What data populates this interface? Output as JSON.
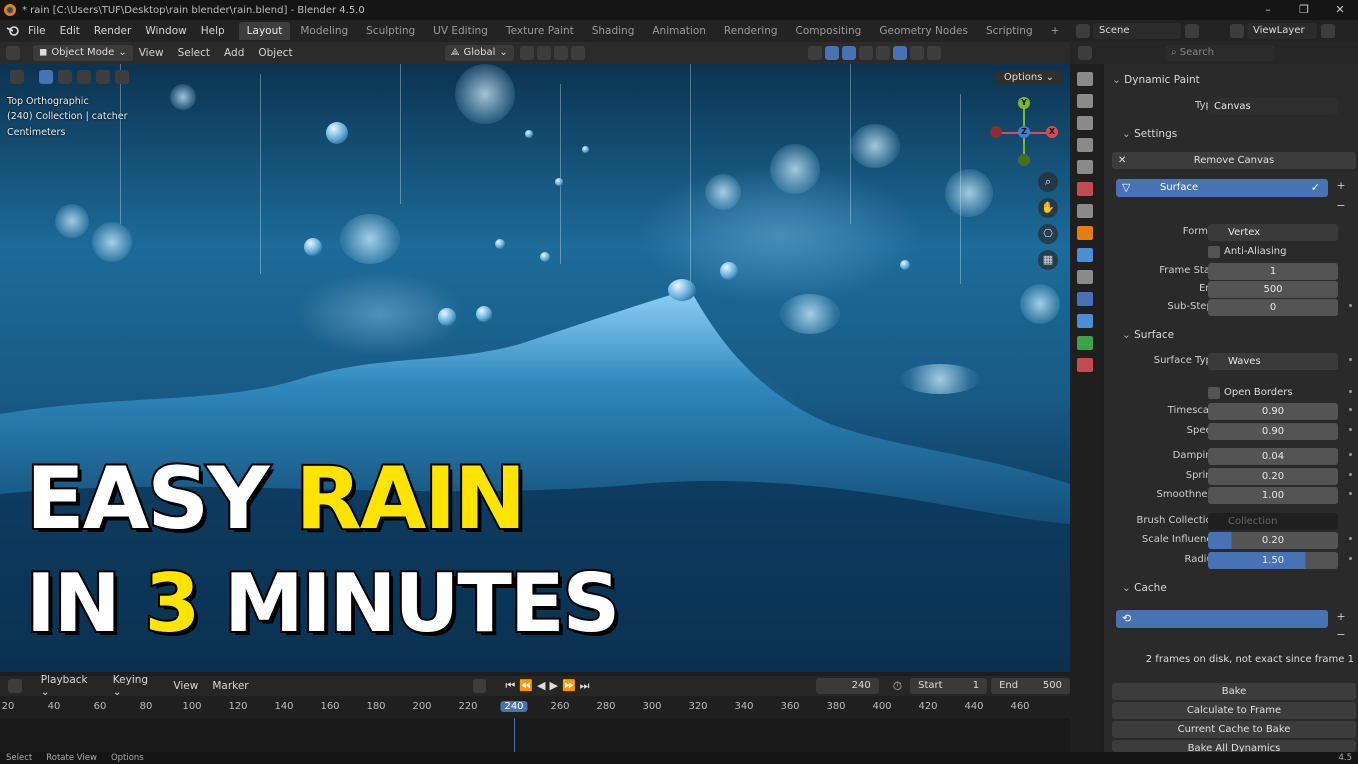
{
  "window": {
    "title": "* rain [C:\\Users\\TUF\\Desktop\\rain blender\\rain.blend] - Blender 4.5.0",
    "controls": [
      "–",
      "❐",
      "✕"
    ]
  },
  "menu": [
    "File",
    "Edit",
    "Render",
    "Window",
    "Help"
  ],
  "workspaces": [
    "Layout",
    "Modeling",
    "Sculpting",
    "UV Editing",
    "Texture Paint",
    "Shading",
    "Animation",
    "Rendering",
    "Compositing",
    "Geometry Nodes",
    "Scripting",
    "+"
  ],
  "scene_header": {
    "scene": "Scene",
    "view_layer": "ViewLayer"
  },
  "viewport_header": {
    "mode": "Object Mode",
    "menus": [
      "View",
      "Select",
      "Add",
      "Object"
    ],
    "orientation": "Global"
  },
  "viewport": {
    "view_name": "Top Orthographic",
    "collection": "(240) Collection | catcher",
    "units": "Centimeters",
    "options": "Options ⌄",
    "gizmo": {
      "x": "X",
      "y": "Y",
      "z": "Z"
    }
  },
  "thumbnail": {
    "line1_white": "EASY",
    "line1_yellow": "RAIN",
    "line2_white_a": "IN",
    "line2_yellow": "3",
    "line2_white_b": "MINUTES"
  },
  "timeline": {
    "menus": [
      "Playback ⌄",
      "Keying ⌄",
      "View",
      "Marker"
    ],
    "current_frame": "240",
    "start_label": "Start",
    "start": "1",
    "end_label": "End",
    "end": "500",
    "ticks": [
      "20",
      "40",
      "60",
      "80",
      "100",
      "120",
      "140",
      "160",
      "180",
      "200",
      "220",
      "240",
      "260",
      "280",
      "300",
      "320",
      "340",
      "360",
      "380",
      "400",
      "420",
      "440",
      "460"
    ]
  },
  "status": [
    "Select",
    "Rotate View",
    "Options"
  ],
  "version": "4.5",
  "properties": {
    "search_placeholder": "Search",
    "dynamic_paint": "Dynamic Paint",
    "type_label": "Type",
    "type_value": "Canvas",
    "settings": "Settings",
    "remove_canvas": "Remove Canvas",
    "surface_item": "Surface",
    "format_label": "Format",
    "format_value": "Vertex",
    "anti_aliasing": "Anti-Aliasing",
    "frame_start_label": "Frame Start",
    "frame_start": "1",
    "end_label": "End",
    "end": "500",
    "substeps_label": "Sub-Steps",
    "substeps": "0",
    "surface_section": "Surface",
    "surface_type_label": "Surface Type",
    "surface_type": "Waves",
    "open_borders": "Open Borders",
    "timescale_label": "Timescale",
    "timescale": "0.90",
    "speed_label": "Speed",
    "speed": "0.90",
    "damping_label": "Damping",
    "damping": "0.04",
    "spring_label": "Spring",
    "spring": "0.20",
    "smoothness_label": "Smoothness",
    "smoothness": "1.00",
    "brush_collection_label": "Brush Collection",
    "brush_collection": "Collection",
    "scale_influence_label": "Scale Influence",
    "scale_influence": "0.20",
    "radius_label": "Radius",
    "radius": "1.50",
    "cache_section": "Cache",
    "cache_info": "2 frames on disk, not exact since frame 1",
    "bake": "Bake",
    "calculate_to_frame": "Calculate to Frame",
    "current_cache_to_bake": "Current Cache to Bake",
    "bake_all_dynamics": "Bake All Dynamics"
  },
  "colors": {
    "accent": "#4772b3",
    "yellow": "#ffe400",
    "blender_orange": "#e87d0d"
  }
}
